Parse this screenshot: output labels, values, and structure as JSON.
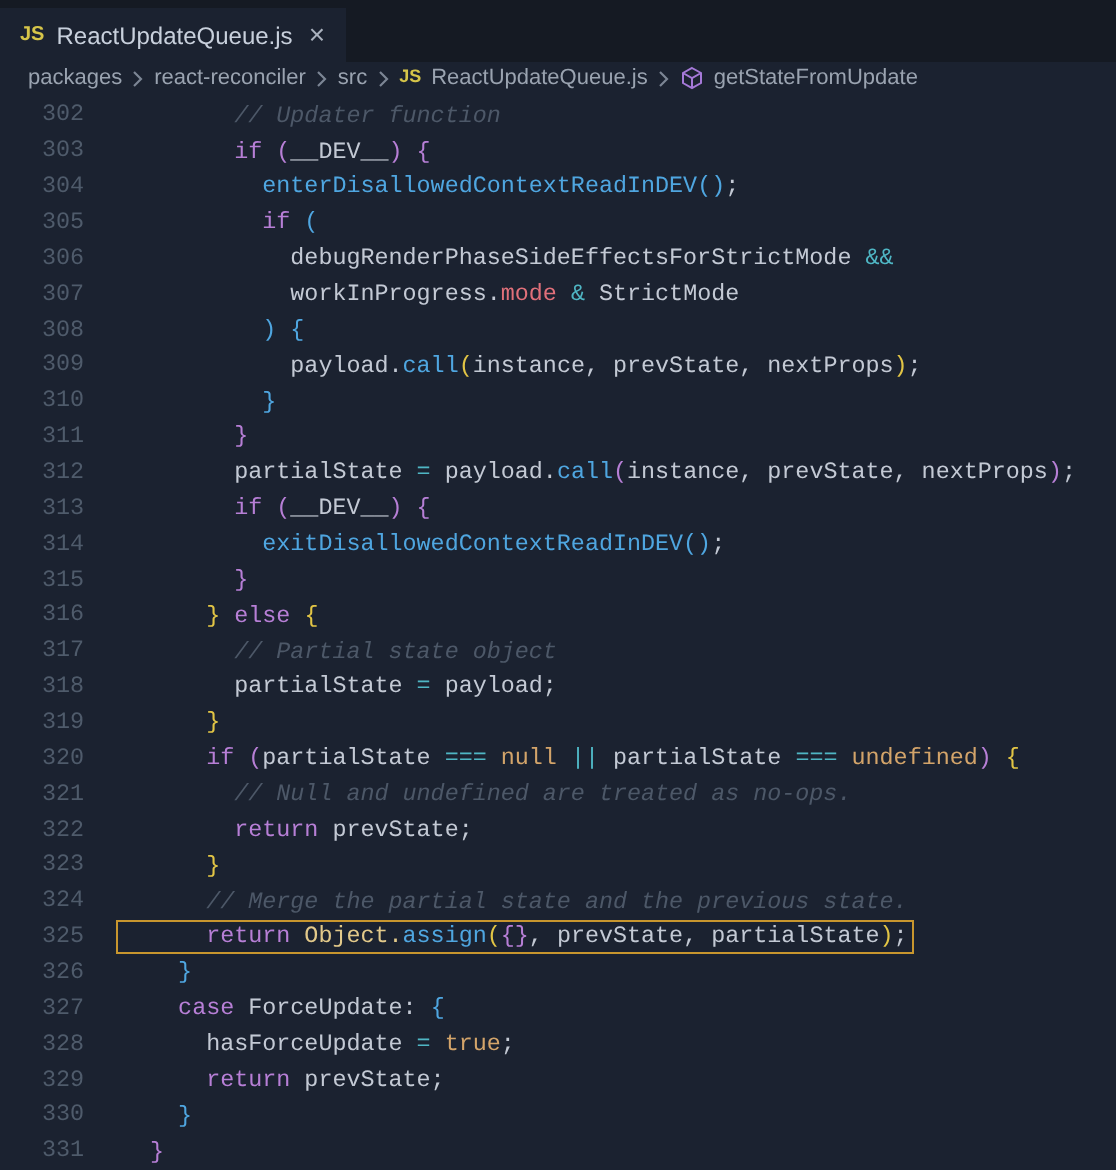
{
  "tabs": [
    {
      "badge": "JS",
      "label": "ReactUpdateQueue.js",
      "selected": true,
      "close": "×"
    }
  ],
  "breadcrumb": [
    {
      "kind": "folder",
      "label": "packages"
    },
    {
      "kind": "folder",
      "label": "react-reconciler"
    },
    {
      "kind": "folder",
      "label": "src"
    },
    {
      "kind": "file",
      "badge": "JS",
      "label": "ReactUpdateQueue.js"
    },
    {
      "kind": "symbol",
      "label": "getStateFromUpdate"
    }
  ],
  "lines": [
    {
      "number": "302",
      "highlighted": false,
      "tokens": [
        {
          "text": "        // Updater function",
          "kind": "comment"
        }
      ]
    },
    {
      "number": "303",
      "highlighted": false,
      "tokens": [
        {
          "text": "        if",
          "kind": "keyword"
        },
        {
          "text": " (",
          "kind": "b2"
        },
        {
          "text": "__DEV__",
          "kind": "plain"
        },
        {
          "text": ")",
          "kind": "b2"
        },
        {
          "text": " {",
          "kind": "b2"
        }
      ]
    },
    {
      "number": "304",
      "highlighted": false,
      "tokens": [
        {
          "text": "          enterDisallowedContextReadInDEV",
          "kind": "function"
        },
        {
          "text": "()",
          "kind": "b3"
        },
        {
          "text": ";",
          "kind": "plain"
        }
      ]
    },
    {
      "number": "305",
      "highlighted": false,
      "tokens": [
        {
          "text": "          if",
          "kind": "keyword"
        },
        {
          "text": " (",
          "kind": "b3"
        }
      ]
    },
    {
      "number": "306",
      "highlighted": false,
      "tokens": [
        {
          "text": "            debugRenderPhaseSideEffectsForStrictMode",
          "kind": "plain"
        },
        {
          "text": " &&",
          "kind": "operator"
        }
      ]
    },
    {
      "number": "307",
      "highlighted": false,
      "tokens": [
        {
          "text": "            workInProgress.",
          "kind": "plain"
        },
        {
          "text": "mode",
          "kind": "property"
        },
        {
          "text": " &",
          "kind": "operator"
        },
        {
          "text": " StrictMode",
          "kind": "plain"
        }
      ]
    },
    {
      "number": "308",
      "highlighted": false,
      "tokens": [
        {
          "text": "          )",
          "kind": "b3"
        },
        {
          "text": " {",
          "kind": "b3"
        }
      ]
    },
    {
      "number": "309",
      "highlighted": false,
      "tokens": [
        {
          "text": "            payload.",
          "kind": "plain"
        },
        {
          "text": "call",
          "kind": "function"
        },
        {
          "text": "(",
          "kind": "b1"
        },
        {
          "text": "instance, prevState, nextProps",
          "kind": "plain"
        },
        {
          "text": ")",
          "kind": "b1"
        },
        {
          "text": ";",
          "kind": "plain"
        }
      ]
    },
    {
      "number": "310",
      "highlighted": false,
      "tokens": [
        {
          "text": "          }",
          "kind": "b3"
        }
      ]
    },
    {
      "number": "311",
      "highlighted": false,
      "tokens": [
        {
          "text": "        }",
          "kind": "b2"
        }
      ]
    },
    {
      "number": "312",
      "highlighted": false,
      "tokens": [
        {
          "text": "        partialState",
          "kind": "plain"
        },
        {
          "text": " =",
          "kind": "operator"
        },
        {
          "text": " payload.",
          "kind": "plain"
        },
        {
          "text": "call",
          "kind": "function"
        },
        {
          "text": "(",
          "kind": "b2"
        },
        {
          "text": "instance, prevState, nextProps",
          "kind": "plain"
        },
        {
          "text": ")",
          "kind": "b2"
        },
        {
          "text": ";",
          "kind": "plain"
        }
      ]
    },
    {
      "number": "313",
      "highlighted": false,
      "tokens": [
        {
          "text": "        if",
          "kind": "keyword"
        },
        {
          "text": " (",
          "kind": "b2"
        },
        {
          "text": "__DEV__",
          "kind": "plain"
        },
        {
          "text": ")",
          "kind": "b2"
        },
        {
          "text": " {",
          "kind": "b2"
        }
      ]
    },
    {
      "number": "314",
      "highlighted": false,
      "tokens": [
        {
          "text": "          exitDisallowedContextReadInDEV",
          "kind": "function"
        },
        {
          "text": "()",
          "kind": "b3"
        },
        {
          "text": ";",
          "kind": "plain"
        }
      ]
    },
    {
      "number": "315",
      "highlighted": false,
      "tokens": [
        {
          "text": "        }",
          "kind": "b2"
        }
      ]
    },
    {
      "number": "316",
      "highlighted": false,
      "tokens": [
        {
          "text": "      }",
          "kind": "b1"
        },
        {
          "text": " else",
          "kind": "keyword"
        },
        {
          "text": " {",
          "kind": "b1"
        }
      ]
    },
    {
      "number": "317",
      "highlighted": false,
      "tokens": [
        {
          "text": "        // Partial state object",
          "kind": "comment"
        }
      ]
    },
    {
      "number": "318",
      "highlighted": false,
      "tokens": [
        {
          "text": "        partialState",
          "kind": "plain"
        },
        {
          "text": " =",
          "kind": "operator"
        },
        {
          "text": " payload;",
          "kind": "plain"
        }
      ]
    },
    {
      "number": "319",
      "highlighted": false,
      "tokens": [
        {
          "text": "      }",
          "kind": "b1"
        }
      ]
    },
    {
      "number": "320",
      "highlighted": false,
      "tokens": [
        {
          "text": "      if",
          "kind": "keyword"
        },
        {
          "text": " (",
          "kind": "b2"
        },
        {
          "text": "partialState",
          "kind": "plain"
        },
        {
          "text": " ===",
          "kind": "operator"
        },
        {
          "text": " null",
          "kind": "constant"
        },
        {
          "text": " ||",
          "kind": "operator"
        },
        {
          "text": " partialState",
          "kind": "plain"
        },
        {
          "text": " ===",
          "kind": "operator"
        },
        {
          "text": " undefined",
          "kind": "constant"
        },
        {
          "text": ")",
          "kind": "b2"
        },
        {
          "text": " {",
          "kind": "b1"
        }
      ]
    },
    {
      "number": "321",
      "highlighted": false,
      "tokens": [
        {
          "text": "        // Null and undefined are treated as no-ops.",
          "kind": "comment"
        }
      ]
    },
    {
      "number": "322",
      "highlighted": false,
      "tokens": [
        {
          "text": "        return",
          "kind": "keyword"
        },
        {
          "text": " prevState;",
          "kind": "plain"
        }
      ]
    },
    {
      "number": "323",
      "highlighted": false,
      "tokens": [
        {
          "text": "      }",
          "kind": "b1"
        }
      ]
    },
    {
      "number": "324",
      "highlighted": false,
      "tokens": [
        {
          "text": "      // Merge the partial state and the previous state.",
          "kind": "comment"
        }
      ]
    },
    {
      "number": "325",
      "highlighted": true,
      "tokens": [
        {
          "text": "      return",
          "kind": "keyword"
        },
        {
          "text": " Object.",
          "kind": "type"
        },
        {
          "text": "assign",
          "kind": "function"
        },
        {
          "text": "(",
          "kind": "b1"
        },
        {
          "text": "{}",
          "kind": "b2"
        },
        {
          "text": ", prevState, partialState",
          "kind": "plain"
        },
        {
          "text": ")",
          "kind": "b1"
        },
        {
          "text": ";",
          "kind": "plain"
        }
      ]
    },
    {
      "number": "326",
      "highlighted": false,
      "tokens": [
        {
          "text": "    }",
          "kind": "b3"
        }
      ]
    },
    {
      "number": "327",
      "highlighted": false,
      "tokens": [
        {
          "text": "    case",
          "kind": "keyword"
        },
        {
          "text": " ForceUpdate: ",
          "kind": "plain"
        },
        {
          "text": "{",
          "kind": "b3"
        }
      ]
    },
    {
      "number": "328",
      "highlighted": false,
      "tokens": [
        {
          "text": "      hasForceUpdate",
          "kind": "plain"
        },
        {
          "text": " =",
          "kind": "operator"
        },
        {
          "text": " true",
          "kind": "constant"
        },
        {
          "text": ";",
          "kind": "plain"
        }
      ]
    },
    {
      "number": "329",
      "highlighted": false,
      "tokens": [
        {
          "text": "      return",
          "kind": "keyword"
        },
        {
          "text": " prevState;",
          "kind": "plain"
        }
      ]
    },
    {
      "number": "330",
      "highlighted": false,
      "tokens": [
        {
          "text": "    }",
          "kind": "b3"
        }
      ]
    },
    {
      "number": "331",
      "highlighted": false,
      "tokens": [
        {
          "text": "  }",
          "kind": "b2"
        }
      ]
    }
  ]
}
